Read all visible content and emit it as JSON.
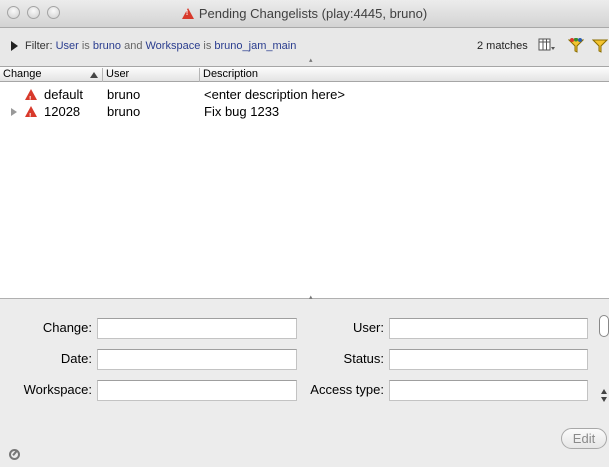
{
  "window": {
    "title": "Pending Changelists (play:4445, bruno)"
  },
  "filter": {
    "label": "Filter:",
    "field1": "User",
    "is1": "is",
    "value1": "bruno",
    "and": "and",
    "field2": "Workspace",
    "is2": "is",
    "value2": "bruno_jam_main",
    "matches": "2 matches"
  },
  "columns": {
    "change": "Change",
    "user": "User",
    "description": "Description"
  },
  "rows": [
    {
      "change": "default",
      "user": "bruno",
      "description": "<enter description here>",
      "expandable": false
    },
    {
      "change": "12028",
      "user": "bruno",
      "description": "Fix bug 1233",
      "expandable": true
    }
  ],
  "details": {
    "change_label": "Change:",
    "date_label": "Date:",
    "workspace_label": "Workspace:",
    "user_label": "User:",
    "status_label": "Status:",
    "access_type_label": "Access type:",
    "change_value": "",
    "date_value": "",
    "workspace_value": "",
    "user_value": "",
    "status_value": "",
    "access_type_value": "",
    "edit_label": "Edit"
  },
  "icons": {
    "window_status": "warning-icon",
    "toolbar": [
      "column-chooser-icon",
      "color-filter-icon",
      "filter-icon"
    ],
    "footer": "refresh-status-icon"
  },
  "colors": {
    "warning": "#d8392b",
    "filter_keyword": "#2a3d8f"
  }
}
